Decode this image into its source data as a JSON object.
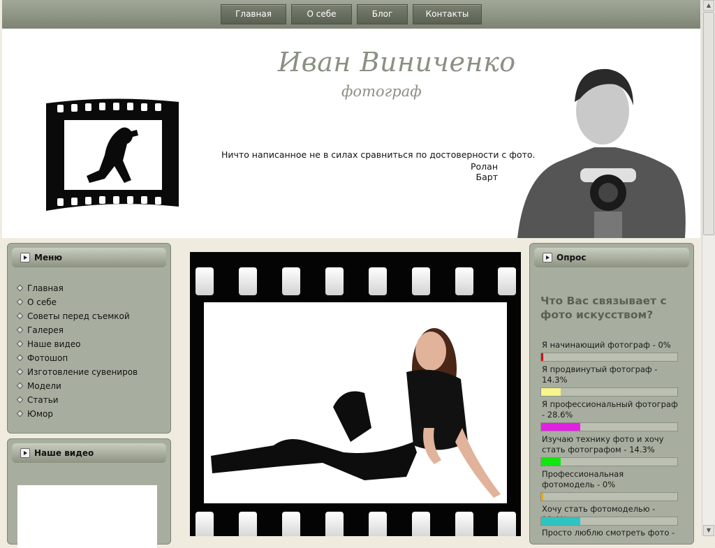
{
  "nav": [
    "Главная",
    "О себе",
    "Блог",
    "Контакты"
  ],
  "header": {
    "title": "Иван Виниченко",
    "subtitle": "фотограф",
    "quote": "Ничто написанное не в силах сравниться по достоверности с фото.",
    "quote_author": "Ролан Барт"
  },
  "menu": {
    "title": "Меню",
    "items": [
      "Главная",
      "О себе",
      "Советы перед съемкой",
      "Галерея",
      "Наше видео",
      "Фотошоп",
      "Изготовление сувениров",
      "Модели",
      "Статьи",
      "Юмор"
    ]
  },
  "video": {
    "title": "Наше видео"
  },
  "poll": {
    "title": "Опрос",
    "question": "Что Вас связывает с фото искусством?",
    "options": [
      {
        "label": "Я начинающий фотограф - 0%",
        "percent": 0,
        "color": "#d41111"
      },
      {
        "label": "Я продвинутый фотограф - 14.3%",
        "percent": 14.3,
        "color": "#f8f58a"
      },
      {
        "label": "Я профессиональный фотограф - 28.6%",
        "percent": 28.6,
        "color": "#e41fe6"
      },
      {
        "label": "Изучаю технику фото и хочу стать фотографом - 14.3%",
        "percent": 14.3,
        "color": "#11e611"
      },
      {
        "label": "Профессиональная фотомодель - 0%",
        "percent": 0,
        "color": "#e8a815"
      },
      {
        "label": "Хочу стать фотомоделью - 28.6%",
        "percent": 28.6,
        "color": "#2ec4c2"
      },
      {
        "label": "Просто люблю смотреть фото -",
        "percent": 0,
        "color": "#7a7a7a"
      }
    ]
  },
  "colors": {
    "nav_bg": "#7d8473",
    "panel_bg": "#a7ae9f",
    "title": "#8a9082"
  }
}
